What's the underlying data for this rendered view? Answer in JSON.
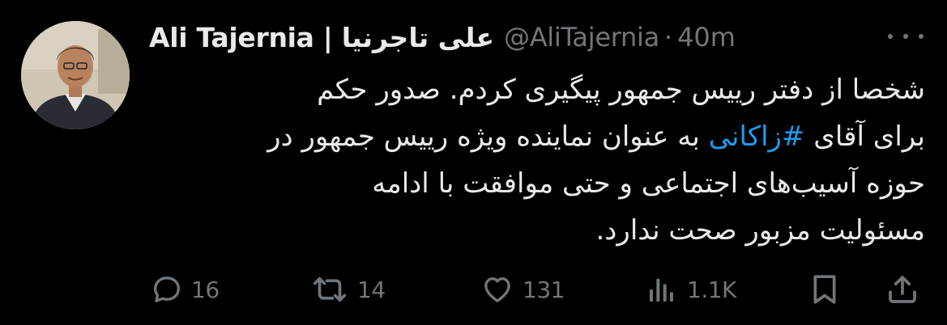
{
  "author": {
    "display_name": "Ali Tajernia | علی تاجرنیا",
    "handle": "@AliTajernia",
    "separator": "·",
    "time": "40m"
  },
  "tweet": {
    "line1": "شخصا از دفتر رییس جمهور پیگیری کردم. صدور حکم",
    "line2_before": "برای آقای ",
    "line2_hashtag": "#زاکانی",
    "line2_after": " به عنوان نماینده ویژه رییس جمهور در",
    "line3": "حوزه آسیب‌های اجتماعی و حتی موافقت با ادامه",
    "line4": "مسئولیت مزبور صحت ندارد."
  },
  "actions": {
    "replies": "16",
    "retweets": "14",
    "likes": "131",
    "views": "1.1K"
  },
  "icons": {
    "more": "more-horizontal-icon",
    "reply": "reply-icon",
    "retweet": "retweet-icon",
    "like": "heart-icon",
    "views": "views-icon",
    "bookmark": "bookmark-icon",
    "share": "share-icon"
  },
  "colors": {
    "background": "#000000",
    "text": "#e7e9ea",
    "secondary": "#71767b",
    "hashtag": "#1d9bf0"
  }
}
